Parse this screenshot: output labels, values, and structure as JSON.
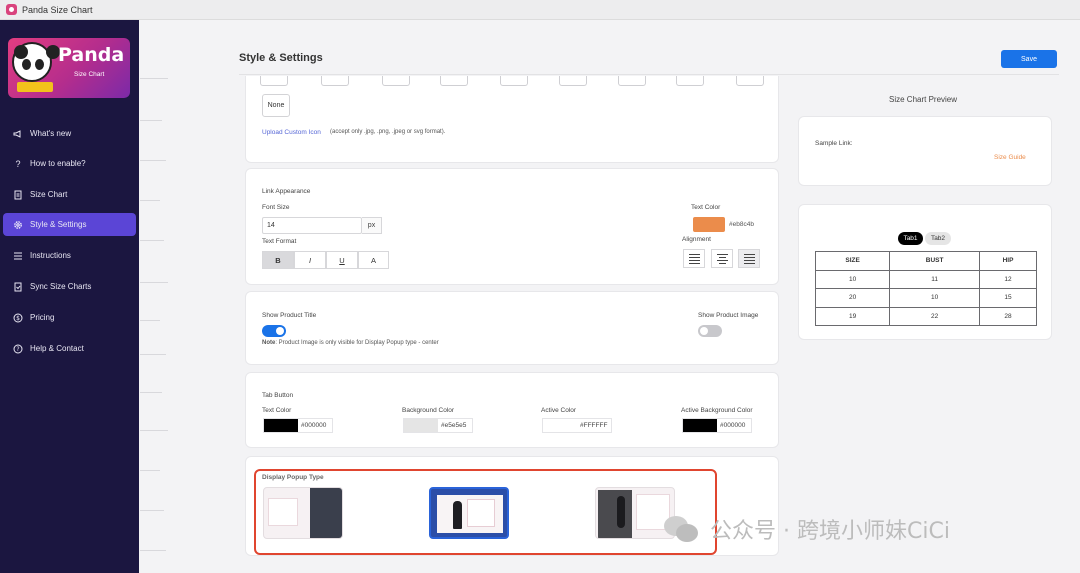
{
  "window": {
    "title": "Panda Size Chart"
  },
  "logo": {
    "title": "Panda",
    "subtitle": "Size Chart"
  },
  "sidebar": {
    "items": [
      {
        "label": "What's new",
        "icon": "megaphone-icon"
      },
      {
        "label": "How to enable?",
        "icon": "question-icon"
      },
      {
        "label": "Size Chart",
        "icon": "document-icon"
      },
      {
        "label": "Style & Settings",
        "icon": "gear-icon",
        "active": true
      },
      {
        "label": "Instructions",
        "icon": "list-icon"
      },
      {
        "label": "Sync Size Charts",
        "icon": "sync-document-icon"
      },
      {
        "label": "Pricing",
        "icon": "dollar-icon"
      },
      {
        "label": "Help & Contact",
        "icon": "help-circle-icon"
      }
    ]
  },
  "header": {
    "title": "Style & Settings",
    "save_label": "Save"
  },
  "icon_section": {
    "none_label": "None",
    "upload_link": "Upload Custom Icon",
    "upload_note": "(accept only .jpg, .png, .jpeg or svg format)."
  },
  "link_appearance": {
    "title": "Link Appearance",
    "font_size_label": "Font Size",
    "font_size_value": "14",
    "font_size_unit": "px",
    "text_format_label": "Text Format",
    "formats": [
      "B",
      "I",
      "U",
      "A"
    ],
    "text_color_label": "Text Color",
    "text_color_hex": "#eb8c4b",
    "alignment_label": "Alignment"
  },
  "product": {
    "show_title_label": "Show Product Title",
    "show_image_label": "Show Product Image",
    "note_bold": "Note",
    "note_text": ": Product Image is only visible for Display Popup type - center",
    "show_title_on": true,
    "show_image_on": false
  },
  "tab_button": {
    "title": "Tab Button",
    "colors": [
      {
        "label": "Text Color",
        "hex": "#000000",
        "swatch": "#000000"
      },
      {
        "label": "Background Color",
        "hex": "#e5e5e5",
        "swatch": "#e5e5e5"
      },
      {
        "label": "Active Color",
        "hex": "#FFFFFF",
        "swatch": "#FFFFFF"
      },
      {
        "label": "Active Background Color",
        "hex": "#000000",
        "swatch": "#000000"
      }
    ]
  },
  "popup": {
    "title": "Display Popup Type"
  },
  "preview": {
    "title": "Size Chart Preview",
    "sample_link_label": "Sample Link:",
    "size_guide_label": "Size Guide",
    "size_guide_color": "#eb8c4b",
    "tabs": [
      "Tab1",
      "Tab2"
    ],
    "table": {
      "headers": [
        "SIZE",
        "BUST",
        "HIP"
      ],
      "rows": [
        [
          "10",
          "11",
          "12"
        ],
        [
          "20",
          "10",
          "15"
        ],
        [
          "19",
          "22",
          "28"
        ]
      ]
    }
  },
  "watermark": {
    "text": "公众号 · 跨境小师妹CiCi"
  },
  "colors": {
    "sidebar": "#1b1640",
    "accent": "#5b45d6",
    "primary": "#1a73e8",
    "highlight": "#e0452f"
  }
}
